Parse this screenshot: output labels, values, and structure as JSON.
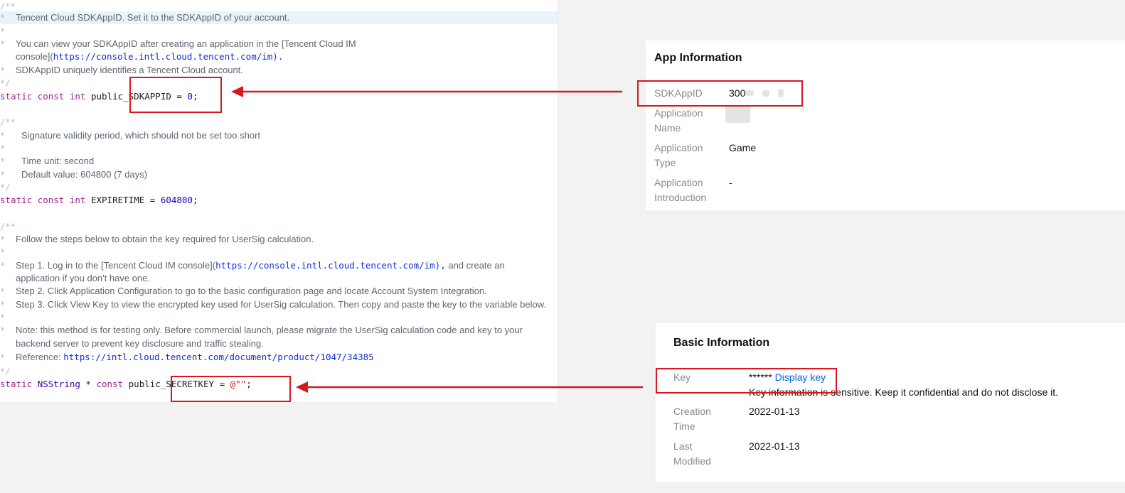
{
  "code": {
    "lines": [
      {
        "gutter": "/**",
        "text": ""
      },
      {
        "gutter": "*",
        "text": "Tencent Cloud SDKAppID. Set it to the SDKAppID of your account."
      },
      {
        "gutter": "*",
        "text": ""
      },
      {
        "gutter": "*",
        "text": "You can view your SDKAppID after creating an application in the [Tencent Cloud IM"
      },
      {
        "gutter": "",
        "text": "console](",
        "url": "https://console.intl.cloud.tencent.com/im).",
        "text_after": ""
      },
      {
        "gutter": "*",
        "text": "SDKAppID uniquely identifies a Tencent Cloud account."
      },
      {
        "gutter": "*/",
        "text": ""
      },
      {
        "gutter": "/**",
        "text": ""
      },
      {
        "gutter": "*",
        "text": "Signature validity period, which should not be set too short"
      },
      {
        "gutter": "*",
        "text": ""
      },
      {
        "gutter": "*",
        "text": "Time unit: second"
      },
      {
        "gutter": "*",
        "text": "Default value: 604800 (7 days)"
      },
      {
        "gutter": "*/",
        "text": ""
      },
      {
        "gutter": "/**",
        "text": ""
      },
      {
        "gutter": "*",
        "text": "Follow the steps below to obtain the key required for UserSig calculation."
      },
      {
        "gutter": "*",
        "text": ""
      },
      {
        "gutter": "*",
        "text": "Step 1. Log in to the [Tencent Cloud IM console](",
        "url": "https://console.intl.cloud.tencent.com/im),",
        "text_after": " and create an"
      },
      {
        "gutter": "",
        "text": "application if you don't have one."
      },
      {
        "gutter": "*",
        "text": "Step 2. Click Application Configuration to go to the basic configuration page and locate Account System Integration."
      },
      {
        "gutter": "*",
        "text": "Step 3. Click View Key to view the encrypted key used for UserSig calculation. Then copy and paste the key to the variable below."
      },
      {
        "gutter": "*",
        "text": ""
      },
      {
        "gutter": "*",
        "text": "Note: this method is for testing only. Before commercial launch, please migrate the UserSig calculation code and key to your"
      },
      {
        "gutter": "",
        "text": "backend server to prevent key disclosure and traffic stealing."
      },
      {
        "gutter": "*",
        "text": "Reference: ",
        "url": "https://intl.cloud.tencent.com/document/product/1047/34385",
        "text_after": ""
      },
      {
        "gutter": "*/",
        "text": ""
      }
    ],
    "stmt_sdkappid": {
      "kw1": "static",
      "kw2": "const",
      "kw3": "int",
      "name": "public_SDKAPPID",
      "eq": " = ",
      "value": "0",
      "end": ";"
    },
    "stmt_expire": {
      "kw1": "static",
      "kw2": "const",
      "kw3": "int",
      "name": "EXPIRETIME",
      "eq": " = ",
      "value": "604800",
      "end": ";"
    },
    "stmt_secret": {
      "kw1": "static",
      "type": "NSString",
      "star": " * ",
      "kw2": "const",
      "name": "public_SECRETKEY",
      "eq": " = ",
      "value": "@\"\"",
      "end": ";"
    }
  },
  "app_info": {
    "title": "App Information",
    "rows": [
      {
        "label": "SDKAppID",
        "value": "300"
      },
      {
        "label": "Application Name",
        "value": ""
      },
      {
        "label": "Application Type",
        "value": "Game"
      },
      {
        "label": "Application Introduction",
        "value": "-"
      }
    ]
  },
  "basic_info": {
    "title": "Basic Information",
    "key_label": "Key",
    "key_mask": "******",
    "key_link": "Display key",
    "key_note": "Key information is sensitive. Keep it confidential and do not disclose it.",
    "created_label": "Creation Time",
    "created_value": "2022-01-13",
    "modified_label": "Last Modified",
    "modified_value": "2022-01-13"
  },
  "colors": {
    "annotation": "#d7191f",
    "link": "#0067d8",
    "keyword": "#9b2393",
    "number": "#1c00cf"
  }
}
